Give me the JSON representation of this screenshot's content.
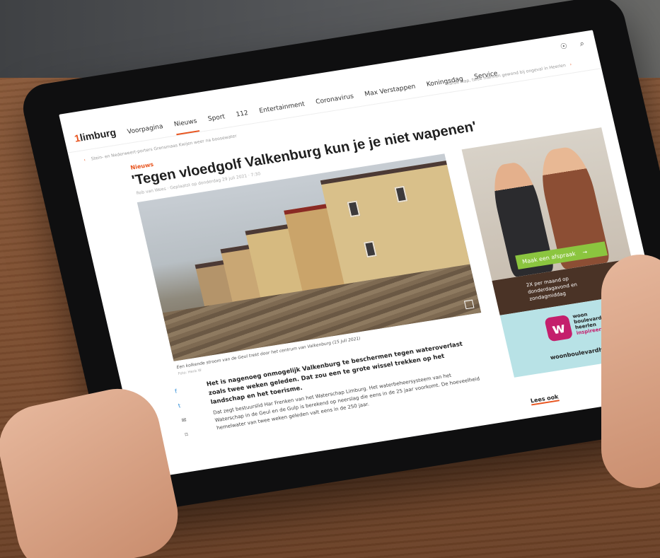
{
  "nav": {
    "logo": "limburg",
    "items": [
      "Voorpagina",
      "Nieuws",
      "Sport",
      "112",
      "Entertainment",
      "Coronavirus",
      "Max Verstappen",
      "Koningsdag",
      "Service"
    ],
    "active_index": 1,
    "top_link": "Harde klap, twee mannen gewond bij ongeval in Heerlen"
  },
  "breadcrumb": "Stein- en Nederweert-porters Grensmaas Kwijen weer na boosewater",
  "article": {
    "kicker": "Nieuws",
    "headline": "'Tegen vloedgolf Valkenburg kun je je niet wapenen'",
    "byline": "Rob van Wees · Geplaatst op donderdag 29 juli 2021 · 7:30",
    "caption": "Een kolkende stroom van de Geul trekt door het centrum van Valkenburg (15 juli 2021)",
    "credit": "Foto: Henk W",
    "lead": "Het is nagenoeg onmogelijk Valkenburg te beschermen tegen wateroverlast zoals twee weken geleden. Dat zou een te grote wissel trekken op het landschap en het toerisme.",
    "paragraph": "Dat zegt bestuurslid Har Frenken van het Waterschap Limburg. Het waterbeheersysteem van het Waterschap in de Geul en de Gulp is berekend op neerslag die eens in de 25 jaar voorkomt. De hoeveelheid hemelwater van twee weken geleden valt eens in de 250 jaar."
  },
  "share": {
    "facebook": "f",
    "twitter": "t",
    "mail": "✉",
    "bookmark": "⌑"
  },
  "ad": {
    "cta": "Maak een afspraak",
    "cta_arrow": "→",
    "offer": "2X per maand op donderdagavond en zondagmiddag",
    "logo_letter": "w",
    "brand_lines": [
      "woon",
      "boulevard",
      "heerlen"
    ],
    "brand_tag": "inspireert",
    "url": "woonboulevardheerlen.nl"
  },
  "lees_ook": "Lees ook",
  "icons": {
    "user": "user-icon",
    "search": "search-icon",
    "bell": "bell-icon"
  },
  "colors": {
    "accent": "#e8541e",
    "cta_green": "#8bc53f",
    "brand_magenta": "#c41f6c"
  }
}
